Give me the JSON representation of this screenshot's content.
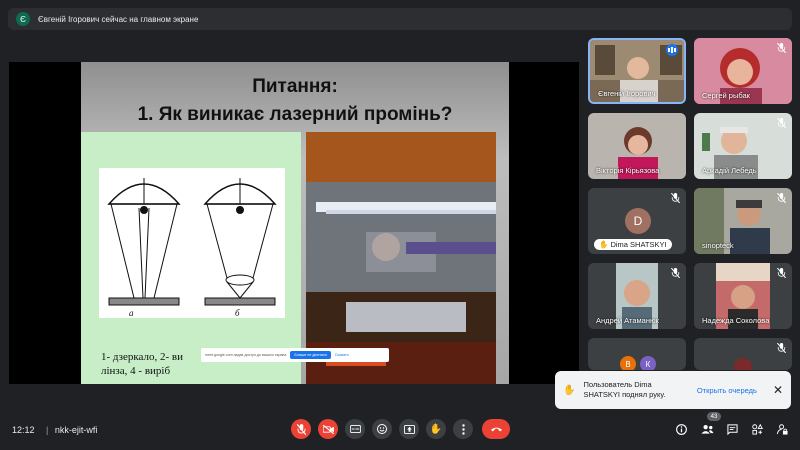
{
  "banner": {
    "avatar_letter": "Є",
    "text": "Євгеній Ігорович сейчас на главном экране"
  },
  "slide": {
    "title_line1": "Питання:",
    "title_line2": "1. Як виникає лазерний промінь?",
    "caption_line1": "1-  дзеркало, 2-  ви",
    "caption_line2": "лінза, 4 - виріб",
    "label_a": "а",
    "label_b": "б",
    "popup_text": "meet.google.com надає доступ до вашого екрана",
    "popup_button": "Більше не ділитися",
    "popup_link": "Сховати"
  },
  "participants": [
    {
      "name": "Євгеній Ігорович",
      "speaking": true
    },
    {
      "name": "Сергей рыбак",
      "muted": true
    },
    {
      "name": "Вікторія Кірьязова",
      "muted": false
    },
    {
      "name": "Аркадій Лебедь",
      "muted": true
    },
    {
      "name": "Dima SHATSKYI",
      "avatar_letter": "D",
      "muted": true
    },
    {
      "name": "sinopteck",
      "muted": true
    },
    {
      "name": "Андрей Атаманюк",
      "muted": true
    },
    {
      "name": "Надежда Соколова",
      "muted": true
    },
    {
      "avatar_letters": [
        "В",
        "К"
      ],
      "muted": true
    }
  ],
  "toast": {
    "text": "Пользователь Dima SHATSKYI поднял руку.",
    "action": "Открыть очередь",
    "close": "✕"
  },
  "bottom": {
    "time": "12:12",
    "separator": "|",
    "meeting_code": "nkk-ejit-wfi",
    "participant_count": "43"
  },
  "colors": {
    "accent": "#1a73e8",
    "danger": "#ea4335",
    "background": "#202124",
    "toolbar_button": "#3c4043"
  },
  "icons": [
    "mic-off-icon",
    "camera-off-icon",
    "captions-icon",
    "emoji-icon",
    "present-icon",
    "raise-hand-icon",
    "more-icon",
    "end-call-icon",
    "info-icon",
    "people-icon",
    "chat-icon",
    "activities-icon"
  ]
}
